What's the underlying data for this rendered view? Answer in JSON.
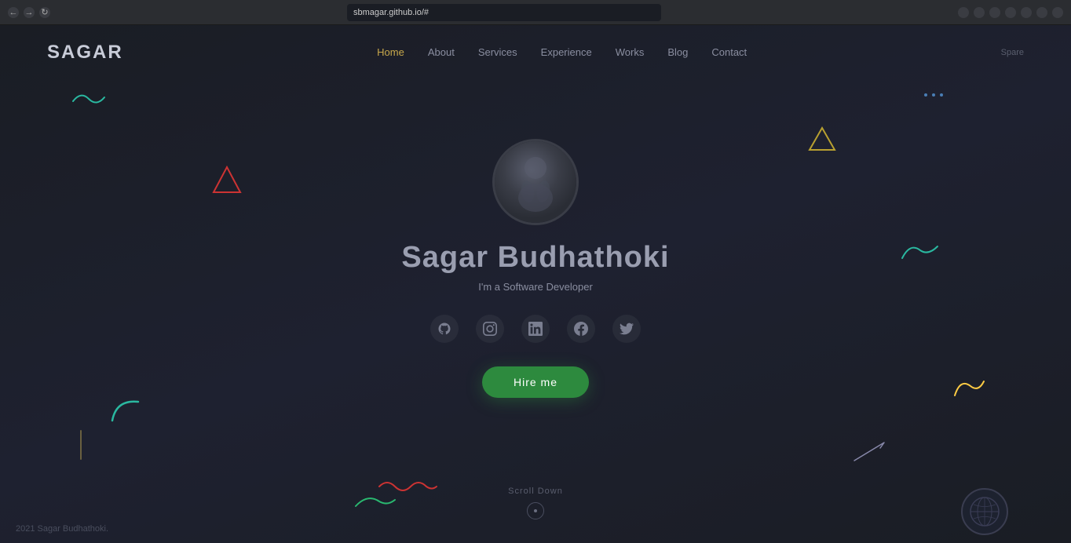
{
  "browser": {
    "url": "sbmagar.github.io/#",
    "cursor_visible": true
  },
  "nav": {
    "logo": "SAGAR",
    "links": [
      {
        "label": "Home",
        "active": true
      },
      {
        "label": "About",
        "active": false
      },
      {
        "label": "Services",
        "active": false
      },
      {
        "label": "Experience",
        "active": false
      },
      {
        "label": "Works",
        "active": false
      },
      {
        "label": "Blog",
        "active": false
      },
      {
        "label": "Contact",
        "active": false
      }
    ],
    "spare_label": "Spare"
  },
  "hero": {
    "name": "Sagar Budhathoki",
    "subtitle_prefix": "I'm a ",
    "subtitle_role": "Software Developer",
    "hire_button": "Hire me",
    "scroll_text": "Scroll Down"
  },
  "social": {
    "icons": [
      {
        "name": "github-icon",
        "symbol": "♦"
      },
      {
        "name": "instagram-icon",
        "symbol": "◎"
      },
      {
        "name": "linkedin-icon",
        "symbol": "in"
      },
      {
        "name": "facebook-icon",
        "symbol": "f"
      },
      {
        "name": "twitter-icon",
        "symbol": "🐦"
      }
    ]
  },
  "footer": {
    "copyright": "2021 Sagar Budhathoki."
  }
}
